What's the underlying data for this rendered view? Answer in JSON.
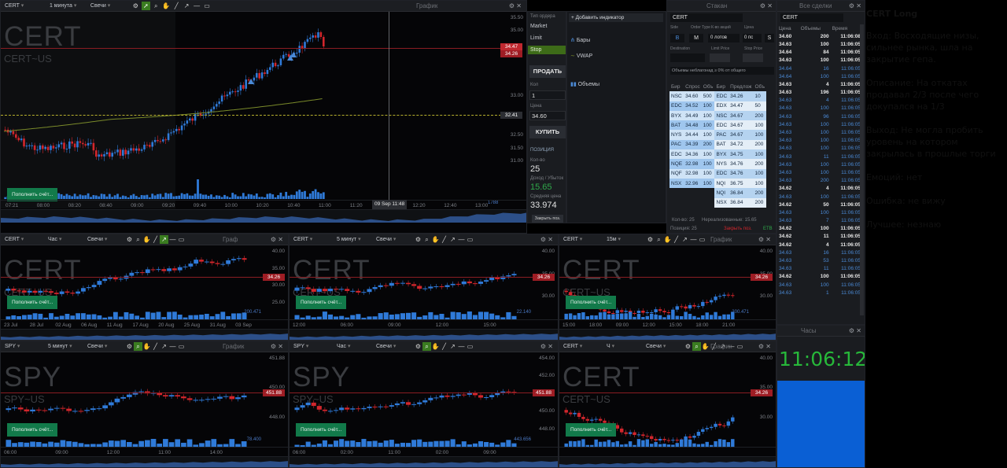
{
  "main_chart": {
    "title": "График",
    "symbol": "CERT",
    "interval": "1 минута",
    "type": "Свечи",
    "watermark": "CERT",
    "watermark_sub": "CERT~US",
    "deposit": "Пополнить счёт...",
    "price_tags": [
      "34.47",
      "34.26"
    ],
    "crosshair_price": "32.41",
    "crosshair_time": "09 Sep 11:48",
    "volume_label": "1788",
    "y_ticks": [
      "35.50",
      "35.00",
      "33.00",
      "32.50",
      "31.50",
      "31.00"
    ],
    "x_ticks": [
      "07:21",
      "08:00",
      "08:20",
      "08:40",
      "09:00",
      "09:20",
      "09:40",
      "10:00",
      "10:20",
      "10:40",
      "11:00",
      "11:20",
      "12:00",
      "12:20",
      "12:40",
      "13:00"
    ]
  },
  "order_panel": {
    "order_type_label": "Тип ордера",
    "types": [
      "Market",
      "Limit",
      "Stop"
    ],
    "sell": "ПРОДАТЬ",
    "qty_label": "Кол",
    "qty": "1",
    "price_label": "Цена",
    "price": "34.60",
    "buy": "КУПИТЬ",
    "position_label": "ПОЗИЦИЯ",
    "position_qty": "25",
    "pnl_label": "Доход / Убыток",
    "pnl": "15.65",
    "avg_label": "Средняя цена",
    "avg_price": "33.974",
    "close": "Закрыть поз."
  },
  "indicators": {
    "add": "+ Добавить индикатор",
    "items": [
      "Бары",
      "VWAP",
      "Объемы"
    ]
  },
  "dom": {
    "title": "Стакан",
    "symbol": "CERT",
    "side_label": "Side",
    "order_type_label": "Order Type",
    "qty_label": "К-во акций",
    "qty": "0 лотов",
    "price_label": "Цена",
    "price": "0 пс",
    "dest_label": "Destination",
    "limit_label": "Limit Price",
    "stop_label": "Stop Price",
    "side": "B",
    "type": "M",
    "tif": "S",
    "vol_note": "Объемы неблагонад ≥ 0% от общего",
    "bid_headers": [
      "Бир",
      "Спрос",
      "Объ"
    ],
    "ask_headers": [
      "Бир",
      "Предлож",
      "Объ"
    ],
    "bids": [
      [
        "NSC",
        "34.60",
        "500"
      ],
      [
        "EDC",
        "34.52",
        "100"
      ],
      [
        "BYX",
        "34.49",
        "100"
      ],
      [
        "BAT",
        "34.48",
        "100"
      ],
      [
        "NYS",
        "34.44",
        "100"
      ],
      [
        "PAC",
        "34.39",
        "200"
      ],
      [
        "EDC",
        "34.36",
        "100"
      ],
      [
        "NQE",
        "32.98",
        "100"
      ],
      [
        "NQF",
        "32.98",
        "100"
      ],
      [
        "NSX",
        "32.96",
        "100"
      ]
    ],
    "asks": [
      [
        "EDC",
        "34.26",
        "10"
      ],
      [
        "EDX",
        "34.47",
        "50"
      ],
      [
        "NSC",
        "34.67",
        "200"
      ],
      [
        "EDC",
        "34.67",
        "100"
      ],
      [
        "PAC",
        "34.67",
        "100"
      ],
      [
        "BAT",
        "34.72",
        "200"
      ],
      [
        "BYX",
        "34.75",
        "100"
      ],
      [
        "NYS",
        "34.76",
        "200"
      ],
      [
        "EDC",
        "34.76",
        "100"
      ],
      [
        "NQI",
        "36.75",
        "100"
      ],
      [
        "NQI",
        "36.84",
        "200"
      ],
      [
        "NSX",
        "36.84",
        "200"
      ]
    ],
    "footer_left": "Кол-во: 25",
    "footer_mid": "Нереализованные: 15.65",
    "footer_right": "ETB",
    "pos_label": "Позиция: 25",
    "close_label": "Закрыть поз."
  },
  "time_sales": {
    "title": "Все сделки",
    "symbol": "CERT",
    "headers": [
      "Цена",
      "Объемы",
      "Время"
    ],
    "rows": [
      [
        "34.60",
        "200",
        "11:06:08",
        "b"
      ],
      [
        "34.63",
        "100",
        "11:06:05",
        "b"
      ],
      [
        "34.64",
        "84",
        "11:06:05",
        "b"
      ],
      [
        "34.63",
        "100",
        "11:06:05",
        "b"
      ],
      [
        "34.64",
        "16",
        "11:06:05",
        "s"
      ],
      [
        "34.64",
        "100",
        "11:06:05",
        "s"
      ],
      [
        "34.63",
        "4",
        "11:06:05",
        "b"
      ],
      [
        "34.63",
        "196",
        "11:06:05",
        "b"
      ],
      [
        "34.63",
        "4",
        "11:06:05",
        "s"
      ],
      [
        "34.63",
        "100",
        "11:06:05",
        "s"
      ],
      [
        "34.63",
        "96",
        "11:06:05",
        "s"
      ],
      [
        "34.63",
        "100",
        "11:06:05",
        "s"
      ],
      [
        "34.63",
        "100",
        "11:06:05",
        "s"
      ],
      [
        "34.63",
        "100",
        "11:06:05",
        "s"
      ],
      [
        "34.63",
        "100",
        "11:06:05",
        "s"
      ],
      [
        "34.63",
        "11",
        "11:06:05",
        "s"
      ],
      [
        "34.63",
        "100",
        "11:06:05",
        "s"
      ],
      [
        "34.63",
        "100",
        "11:06:05",
        "s"
      ],
      [
        "34.63",
        "200",
        "11:06:05",
        "s"
      ],
      [
        "34.62",
        "4",
        "11:06:05",
        "b"
      ],
      [
        "34.63",
        "100",
        "11:06:05",
        "s"
      ],
      [
        "34.62",
        "50",
        "11:06:05",
        "b"
      ],
      [
        "34.63",
        "100",
        "11:06:05",
        "s"
      ],
      [
        "34.63",
        "7",
        "11:06:05",
        "s"
      ],
      [
        "34.62",
        "100",
        "11:06:05",
        "b"
      ],
      [
        "34.62",
        "11",
        "11:06:05",
        "b"
      ],
      [
        "34.62",
        "4",
        "11:06:05",
        "b"
      ],
      [
        "34.63",
        "16",
        "11:06:05",
        "s"
      ],
      [
        "34.63",
        "53",
        "11:06:05",
        "s"
      ],
      [
        "34.63",
        "11",
        "11:06:05",
        "s"
      ],
      [
        "34.62",
        "100",
        "11:06:05",
        "b"
      ],
      [
        "34.63",
        "100",
        "11:06:05",
        "s"
      ],
      [
        "34.63",
        "1",
        "11:06:05",
        "s"
      ]
    ]
  },
  "clock": {
    "title": "Часы",
    "time": "11:06:12"
  },
  "minis": [
    {
      "symbol": "CERT",
      "interval": "Час",
      "type": "Свечи",
      "title": "Граф",
      "watermark": "CERT",
      "sub": "CERT~US",
      "deposit": "Пополнить счёт...",
      "tag": "34.26",
      "vol": "200.471",
      "y": [
        "40.00",
        "35.00",
        "30.00",
        "25.00"
      ],
      "x": [
        "23 Jul",
        "28 Jul",
        "02 Aug",
        "06 Aug",
        "11 Aug",
        "17 Aug",
        "20 Aug",
        "25 Aug",
        "31 Aug",
        "03 Sep"
      ]
    },
    {
      "symbol": "CERT",
      "interval": "5 минут",
      "type": "Свечи",
      "title": "",
      "watermark": "CERT",
      "sub": "CERT~US",
      "deposit": "Пополнить счёт...",
      "tag": "34.26",
      "vol": "22.140",
      "y": [
        "40.00",
        "35.00",
        "30.00"
      ],
      "x": [
        "12:00",
        "06:00",
        "09:00",
        "12:00",
        "15:00"
      ]
    },
    {
      "symbol": "CERT",
      "interval": "15м",
      "type": "",
      "title": "График",
      "watermark": "CERT",
      "sub": "CERT~US",
      "deposit": "Пополнить счёт...",
      "tag": "34.26",
      "vol": "200.471",
      "y": [
        "40.00",
        "35.00",
        "30.00"
      ],
      "x": [
        "15:00",
        "18:00",
        "09:00",
        "12:00",
        "15:00",
        "18:00",
        "21:00"
      ]
    },
    {
      "symbol": "SPY",
      "interval": "5 минут",
      "type": "Свечи",
      "title": "График",
      "watermark": "SPY",
      "sub": "SPY~US",
      "deposit": "Пополнить счёт...",
      "tag": "451.88",
      "vol": "78.400",
      "y": [
        "451.88",
        "450.00",
        "448.00"
      ],
      "x": [
        "06:00",
        "09:00",
        "12:00",
        "11:00",
        "14:00"
      ]
    },
    {
      "symbol": "SPY",
      "interval": "Час",
      "type": "Свечи",
      "title": "",
      "watermark": "SPY",
      "sub": "SPY~US",
      "deposit": "Пополнить счёт...",
      "tag": "451.88",
      "vol": "443.656",
      "y": [
        "454.00",
        "452.00",
        "451.88",
        "450.00",
        "448.00"
      ],
      "x": [
        "06:00",
        "02:00",
        "11:00",
        "02:00",
        "09:00"
      ]
    },
    {
      "symbol": "CERT",
      "interval": "Ч",
      "type": "Свечи",
      "title": "График",
      "watermark": "CERT",
      "sub": "CERT~US",
      "deposit": "Пополнить счёт...",
      "tag": "34.26",
      "vol": "",
      "y": [
        "40.00",
        "35.00",
        "30.00"
      ],
      "x": []
    }
  ],
  "notes": {
    "title": "CERT Long",
    "entry": "Вход: Восходящие низы, сильнее рынка, шла на закрытие гепа.",
    "desc": "Описание: На откатах продавал 2/3 после чего докупался на 1/3",
    "exit": "Выход:  Не могла пробить уровень на котором закрылась в прошлые торги",
    "emotions": "Емоций: нет",
    "mistake": "Ошибка: не вижу",
    "best": "Лучшее: незнаю"
  },
  "colors": {
    "up": "#2f7ad8",
    "down": "#d2262c",
    "vwap": "#7a8a2a",
    "accent": "#127a4a",
    "clock": "#27b83a"
  }
}
